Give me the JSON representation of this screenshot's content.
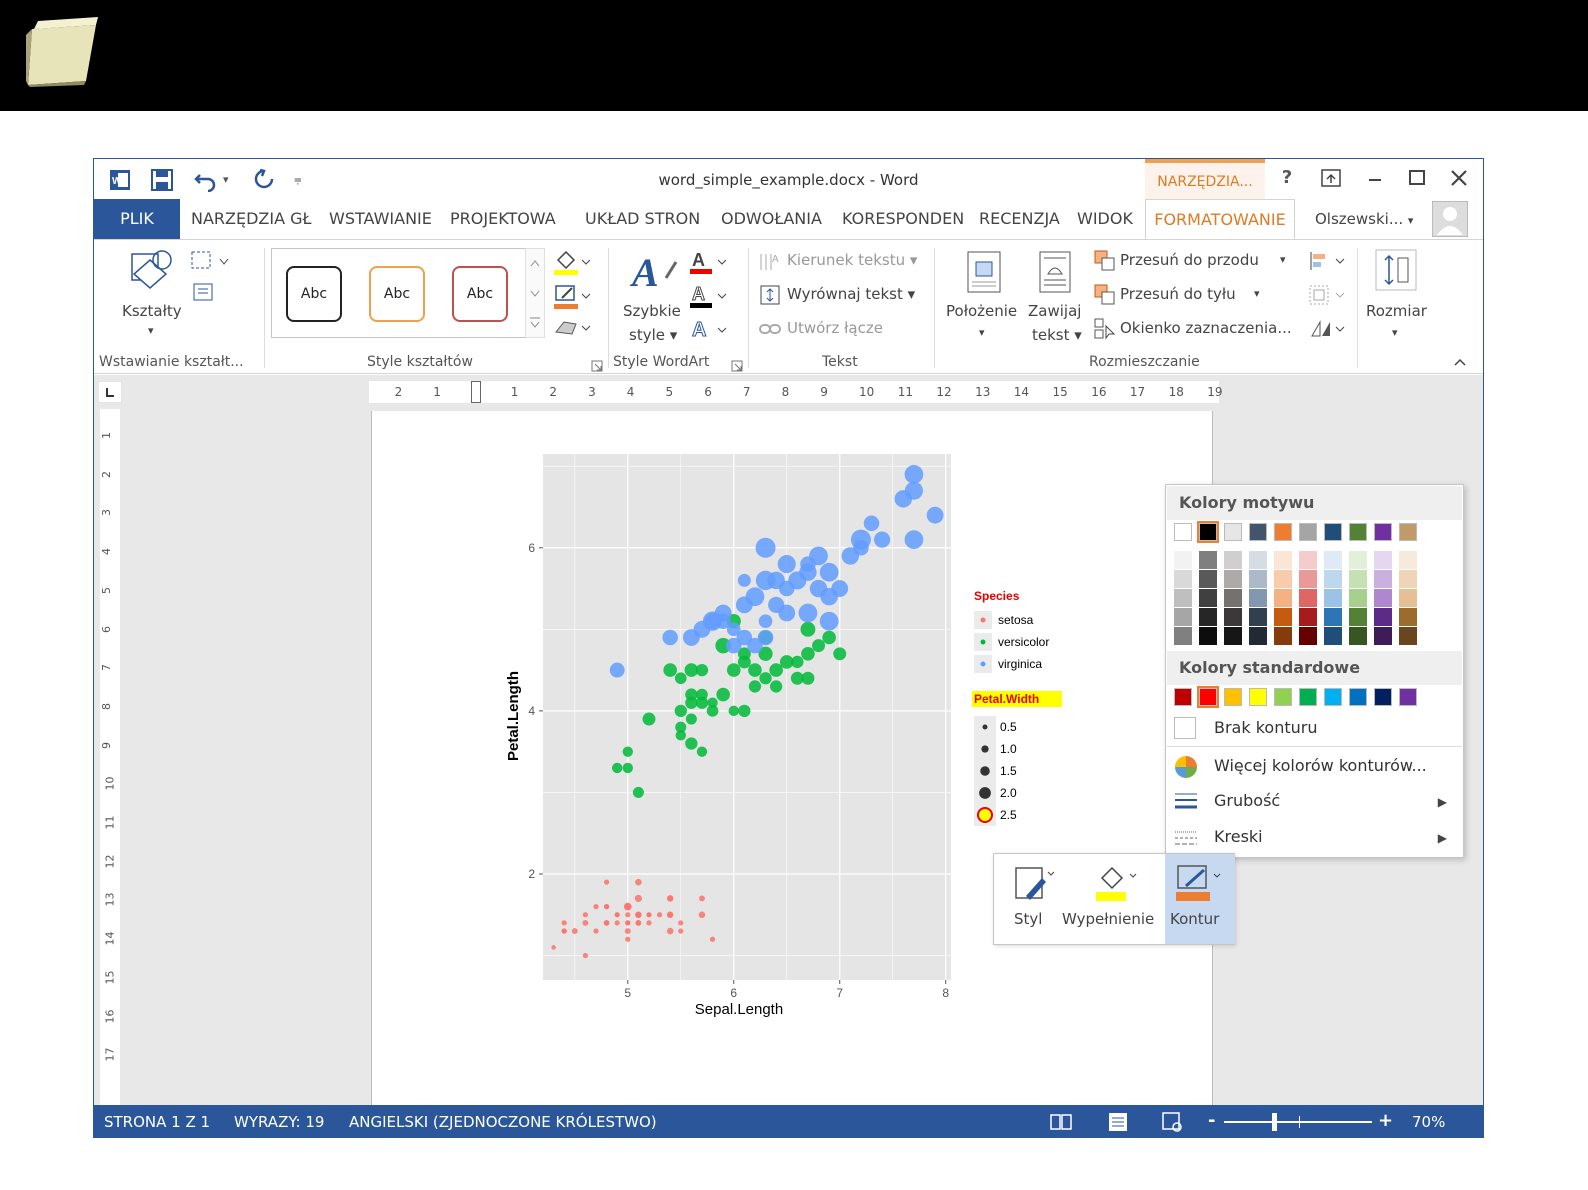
{
  "window": {
    "title": "word_simple_example.docx - Word",
    "context_tab": "NARZĘDZIA...",
    "help": "?",
    "user": "Olszewski...",
    "user_caret": "▾"
  },
  "quick_access": {
    "undo_caret": "▾",
    "customize": "⩦"
  },
  "tabs": [
    "PLIK",
    "NARZĘDZIA GŁ",
    "WSTAWIANIE",
    "PROJEKTOWA",
    "UKŁAD STRON",
    "ODWOŁANIA",
    "KORESPONDEN",
    "RECENZJA",
    "WIDOK",
    "FORMATOWANIE"
  ],
  "ribbon": {
    "shapes_label": "Kształty",
    "abc": [
      "Abc",
      "Abc",
      "Abc"
    ],
    "quick_styles": "Szybkie",
    "quick_styles2": "style ▾",
    "text_direction": "Kierunek tekstu ▾",
    "align_text": "Wyrównaj tekst ▾",
    "create_link": "Utwórz łącze",
    "position": "Położenie",
    "wrap_text": "Zawijaj",
    "wrap_text2": "tekst ▾",
    "bring_forward": "Przesuń do przodu",
    "send_backward": "Przesuń do tyłu",
    "selection_pane": "Okienko zaznaczenia...",
    "size": "Rozmiar",
    "caret": "▾",
    "groups": {
      "insert_shapes": "Wstawianie kształt...",
      "shape_styles": "Style kształtów",
      "wordart_styles": "Style WordArt",
      "text": "Tekst",
      "arrange": "Rozmieszczanie"
    }
  },
  "ruler": {
    "h_ticks": [
      "2",
      "1",
      "1",
      "2",
      "3",
      "4",
      "5",
      "6",
      "7",
      "8",
      "9",
      "10",
      "11",
      "12",
      "13",
      "14",
      "15",
      "16",
      "17",
      "18",
      "19"
    ],
    "v_ticks": [
      "1",
      "2",
      "3",
      "4",
      "5",
      "6",
      "7",
      "8",
      "9",
      "10",
      "11",
      "12",
      "13",
      "14",
      "15",
      "16",
      "17"
    ]
  },
  "chart_data": {
    "type": "scatter",
    "title": "",
    "xlabel": "Sepal.Length",
    "ylabel": "Petal.Length",
    "xlim": [
      4.2,
      8.05
    ],
    "ylim": [
      0.7,
      7.15
    ],
    "xticks": [
      5,
      6,
      7,
      8
    ],
    "yticks": [
      2,
      4,
      6
    ],
    "legend_species_title": "Species",
    "legend_size_title": "Petal.Width",
    "series": [
      {
        "name": "setosa",
        "color": "#f8766d",
        "points": [
          [
            5.1,
            1.4,
            0.2
          ],
          [
            4.9,
            1.4,
            0.2
          ],
          [
            4.7,
            1.3,
            0.2
          ],
          [
            4.6,
            1.5,
            0.2
          ],
          [
            5.0,
            1.4,
            0.2
          ],
          [
            5.4,
            1.7,
            0.4
          ],
          [
            4.6,
            1.4,
            0.3
          ],
          [
            5.0,
            1.5,
            0.2
          ],
          [
            4.4,
            1.4,
            0.2
          ],
          [
            4.9,
            1.5,
            0.1
          ],
          [
            5.4,
            1.5,
            0.2
          ],
          [
            4.8,
            1.6,
            0.2
          ],
          [
            4.8,
            1.4,
            0.1
          ],
          [
            4.3,
            1.1,
            0.1
          ],
          [
            5.8,
            1.2,
            0.2
          ],
          [
            5.7,
            1.5,
            0.4
          ],
          [
            5.4,
            1.3,
            0.4
          ],
          [
            5.1,
            1.4,
            0.3
          ],
          [
            5.7,
            1.7,
            0.3
          ],
          [
            5.1,
            1.5,
            0.3
          ],
          [
            5.4,
            1.7,
            0.2
          ],
          [
            5.1,
            1.5,
            0.4
          ],
          [
            4.6,
            1.0,
            0.2
          ],
          [
            5.1,
            1.7,
            0.5
          ],
          [
            4.8,
            1.9,
            0.2
          ],
          [
            5.0,
            1.6,
            0.2
          ],
          [
            5.0,
            1.6,
            0.4
          ],
          [
            5.2,
            1.5,
            0.2
          ],
          [
            5.2,
            1.4,
            0.2
          ],
          [
            4.7,
            1.6,
            0.2
          ],
          [
            4.8,
            1.6,
            0.2
          ],
          [
            5.4,
            1.5,
            0.4
          ],
          [
            5.2,
            1.5,
            0.1
          ],
          [
            5.5,
            1.4,
            0.2
          ],
          [
            4.9,
            1.5,
            0.2
          ],
          [
            5.0,
            1.2,
            0.2
          ],
          [
            5.5,
            1.3,
            0.2
          ],
          [
            4.4,
            1.3,
            0.2
          ],
          [
            5.1,
            1.5,
            0.2
          ],
          [
            5.0,
            1.3,
            0.3
          ],
          [
            4.5,
            1.3,
            0.3
          ],
          [
            4.4,
            1.3,
            0.2
          ],
          [
            5.0,
            1.6,
            0.6
          ],
          [
            5.1,
            1.9,
            0.4
          ],
          [
            4.8,
            1.4,
            0.3
          ],
          [
            5.3,
            1.5,
            0.2
          ],
          [
            5.0,
            1.4,
            0.2
          ]
        ]
      },
      {
        "name": "versicolor",
        "color": "#00ba38",
        "points": [
          [
            7.0,
            4.7,
            1.4
          ],
          [
            6.4,
            4.5,
            1.5
          ],
          [
            6.9,
            4.9,
            1.5
          ],
          [
            5.5,
            4.0,
            1.3
          ],
          [
            6.5,
            4.6,
            1.5
          ],
          [
            5.7,
            4.5,
            1.3
          ],
          [
            6.3,
            4.7,
            1.6
          ],
          [
            4.9,
            3.3,
            1.0
          ],
          [
            6.6,
            4.6,
            1.3
          ],
          [
            5.2,
            3.9,
            1.4
          ],
          [
            5.0,
            3.5,
            1.0
          ],
          [
            5.9,
            4.2,
            1.5
          ],
          [
            6.0,
            4.0,
            1.0
          ],
          [
            6.1,
            4.7,
            1.4
          ],
          [
            5.6,
            3.6,
            1.3
          ],
          [
            6.7,
            4.4,
            1.4
          ],
          [
            5.6,
            4.5,
            1.5
          ],
          [
            5.8,
            4.1,
            1.0
          ],
          [
            6.2,
            4.5,
            1.5
          ],
          [
            5.6,
            3.9,
            1.1
          ],
          [
            5.9,
            4.8,
            1.8
          ],
          [
            6.1,
            4.0,
            1.3
          ],
          [
            6.3,
            4.9,
            1.5
          ],
          [
            6.4,
            4.3,
            1.3
          ],
          [
            6.6,
            4.4,
            1.4
          ],
          [
            6.8,
            4.8,
            1.4
          ],
          [
            6.7,
            5.0,
            1.7
          ],
          [
            6.0,
            4.5,
            1.5
          ],
          [
            5.7,
            3.5,
            1.0
          ],
          [
            5.5,
            3.8,
            1.1
          ],
          [
            5.5,
            3.7,
            1.0
          ],
          [
            6.0,
            5.1,
            1.6
          ],
          [
            5.4,
            4.5,
            1.5
          ],
          [
            6.7,
            4.7,
            1.5
          ],
          [
            6.3,
            4.4,
            1.3
          ],
          [
            5.6,
            4.1,
            1.3
          ],
          [
            5.5,
            4.4,
            1.2
          ],
          [
            6.1,
            4.6,
            1.4
          ],
          [
            5.8,
            4.0,
            1.2
          ],
          [
            5.0,
            3.3,
            1.0
          ],
          [
            5.6,
            4.2,
            1.3
          ],
          [
            5.7,
            4.2,
            1.2
          ],
          [
            6.2,
            4.3,
            1.3
          ],
          [
            5.1,
            3.0,
            1.1
          ],
          [
            5.7,
            4.1,
            1.3
          ]
        ]
      },
      {
        "name": "virginica",
        "color": "#619cff",
        "points": [
          [
            6.3,
            6.0,
            2.5
          ],
          [
            5.8,
            5.1,
            1.9
          ],
          [
            7.1,
            5.9,
            2.1
          ],
          [
            6.5,
            5.8,
            2.2
          ],
          [
            7.6,
            6.6,
            2.1
          ],
          [
            4.9,
            4.5,
            1.7
          ],
          [
            7.3,
            6.3,
            1.8
          ],
          [
            6.7,
            5.8,
            1.8
          ],
          [
            7.2,
            6.1,
            2.5
          ],
          [
            6.4,
            5.3,
            1.9
          ],
          [
            6.8,
            5.5,
            2.1
          ],
          [
            5.7,
            5.0,
            2.0
          ],
          [
            5.8,
            5.1,
            2.4
          ],
          [
            6.5,
            5.5,
            1.8
          ],
          [
            7.7,
            6.7,
            2.2
          ],
          [
            7.7,
            6.9,
            2.3
          ],
          [
            6.0,
            5.0,
            1.5
          ],
          [
            6.9,
            5.7,
            2.3
          ],
          [
            5.6,
            4.9,
            2.0
          ],
          [
            6.3,
            4.9,
            1.8
          ],
          [
            6.7,
            5.7,
            2.1
          ],
          [
            7.2,
            6.0,
            1.8
          ],
          [
            6.2,
            4.8,
            1.8
          ],
          [
            6.1,
            4.9,
            1.8
          ],
          [
            6.4,
            5.6,
            2.1
          ],
          [
            7.4,
            6.1,
            1.9
          ],
          [
            7.9,
            6.4,
            2.0
          ],
          [
            6.3,
            5.1,
            1.5
          ],
          [
            6.1,
            5.6,
            1.4
          ],
          [
            7.7,
            6.1,
            2.3
          ],
          [
            6.3,
            5.6,
            2.4
          ],
          [
            6.0,
            4.8,
            1.8
          ],
          [
            6.9,
            5.4,
            2.1
          ],
          [
            6.9,
            5.1,
            2.3
          ],
          [
            6.8,
            5.9,
            2.3
          ],
          [
            6.7,
            5.2,
            2.3
          ],
          [
            6.5,
            5.2,
            2.0
          ],
          [
            6.2,
            5.4,
            2.3
          ],
          [
            5.9,
            5.1,
            1.8
          ],
          [
            6.6,
            5.6,
            2.2
          ],
          [
            7.0,
            5.5,
            2.0
          ],
          [
            5.4,
            4.9,
            1.8
          ],
          [
            5.9,
            5.2,
            2.0
          ],
          [
            6.1,
            5.3,
            2.0
          ]
        ]
      }
    ],
    "size_legend": [
      {
        "label": "0.5",
        "value": 0.5
      },
      {
        "label": "1.0",
        "value": 1.0
      },
      {
        "label": "1.5",
        "value": 1.5
      },
      {
        "label": "2.0",
        "value": 2.0
      },
      {
        "label": "2.5",
        "value": 2.5
      }
    ],
    "panel_color": "#e5e5e5",
    "grid": true,
    "legend_position": "right"
  },
  "color_panel": {
    "theme_header": "Kolory motywu",
    "standard_header": "Kolory standardowe",
    "theme_colors": [
      "#ffffff",
      "#000000",
      "#e7e6e6",
      "#44546a",
      "#ed7d31",
      "#a5a5a5",
      "#1f4e79",
      "#548235",
      "#7030a0",
      "#c19a6b"
    ],
    "shade_columns": [
      [
        "#f2f2f2",
        "#d9d9d9",
        "#bfbfbf",
        "#a6a6a6",
        "#808080"
      ],
      [
        "#7f7f7f",
        "#595959",
        "#404040",
        "#262626",
        "#0d0d0d"
      ],
      [
        "#d0cece",
        "#aeaaaa",
        "#757171",
        "#3a3838",
        "#171616"
      ],
      [
        "#d6dce4",
        "#acb9ca",
        "#8497b0",
        "#333f4f",
        "#222a35"
      ],
      [
        "#fbe5d5",
        "#f7cbac",
        "#f4b183",
        "#c55a11",
        "#843c0c"
      ],
      [
        "#f4cccc",
        "#ea9999",
        "#e06666",
        "#a61c1c",
        "#660000"
      ],
      [
        "#deebf6",
        "#bdd7ee",
        "#9cc3e5",
        "#2e75b5",
        "#1e4e79"
      ],
      [
        "#e2efd9",
        "#c5e0b3",
        "#a8d08d",
        "#538135",
        "#375623"
      ],
      [
        "#e4d7ef",
        "#c9b0df",
        "#ae88cf",
        "#5d2b87",
        "#3d1c59"
      ],
      [
        "#f6eadb",
        "#eed5b7",
        "#e5c094",
        "#9c6b2e",
        "#684720"
      ]
    ],
    "standard_colors": [
      "#c00000",
      "#ff0000",
      "#ffc000",
      "#ffff00",
      "#92d050",
      "#00b050",
      "#00b0f0",
      "#0070c0",
      "#002060",
      "#7030a0"
    ],
    "no_outline": "Brak konturu",
    "more_colors": "Więcej kolorów konturów...",
    "weight": "Grubość",
    "dashes": "Kreski",
    "submenu_arrow": "▶"
  },
  "mini_toolbar": {
    "style": "Styl",
    "fill": "Wypełnienie",
    "outline": "Kontur"
  },
  "status": {
    "page": "STRONA 1 Z 1",
    "words": "WYRAZY: 19",
    "language": "ANGIELSKI (ZJEDNOCZONE KRÓLESTWO)",
    "zoom_minus": "-",
    "zoom_plus": "+",
    "zoom": "70%",
    "zoom_level": 0.7
  }
}
